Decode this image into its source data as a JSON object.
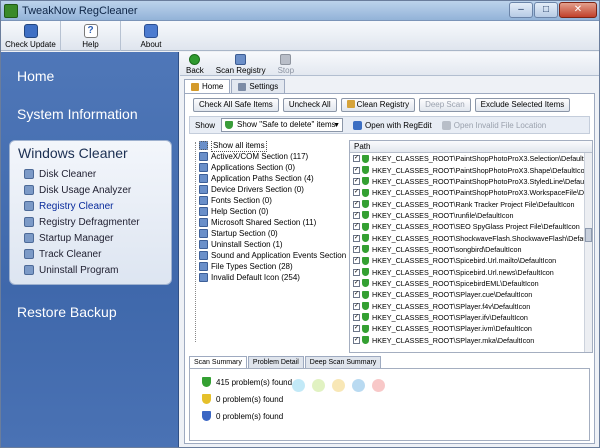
{
  "window": {
    "title": "TweakNow RegCleaner"
  },
  "caption_buttons": {
    "minimize": "–",
    "maximize": "□",
    "close": "✕"
  },
  "toolbar": {
    "check_update": "Check Update",
    "help": "Help",
    "help_glyph": "?",
    "about": "About"
  },
  "sidebar": {
    "home": "Home",
    "system_information": "System Information",
    "windows_cleaner": {
      "title": "Windows Cleaner",
      "items": [
        "Disk Cleaner",
        "Disk Usage Analyzer",
        "Registry Cleaner",
        "Registry Defragmenter",
        "Startup Manager",
        "Track Cleaner",
        "Uninstall Program"
      ],
      "active_index": 2
    },
    "restore_backup": "Restore Backup"
  },
  "subtoolbar": {
    "back": "Back",
    "scan_registry": "Scan Registry",
    "stop": "Stop"
  },
  "tabs": {
    "home": "Home",
    "settings": "Settings"
  },
  "actions": {
    "check_all_safe": "Check All Safe Items",
    "uncheck_all": "Uncheck All",
    "clean_registry": "Clean Registry",
    "deep_scan": "Deep Scan",
    "exclude_selected": "Exclude Selected Items"
  },
  "show": {
    "label": "Show",
    "selected": "Show \"Safe to delete\" items",
    "open_regedit": "Open with RegEdit",
    "open_invalid": "Open Invalid File Location"
  },
  "tree": {
    "items": [
      "Show all items",
      "ActiveX/COM Section (117)",
      "Applications Section (0)",
      "Application Paths Section (4)",
      "Device Drivers Section (0)",
      "Fonts Section (0)",
      "Help Section (0)",
      "Microsoft Shared Section (11)",
      "Startup Section (0)",
      "Uninstall Section (1)",
      "Sound and Application Events Section",
      "File Types Section (28)",
      "Invalid Default Icon (254)"
    ]
  },
  "grid": {
    "column": "Path",
    "rows": [
      "HKEY_CLASSES_ROOT\\PaintShopPhotoProX3.Selection\\DefaultI",
      "HKEY_CLASSES_ROOT\\PaintShopPhotoProX3.Shape\\DefaultIco",
      "HKEY_CLASSES_ROOT\\PaintShopPhotoProX3.StyledLine\\Defaul",
      "HKEY_CLASSES_ROOT\\PaintShopPhotoProX3.WorkspaceFile\\De",
      "HKEY_CLASSES_ROOT\\Rank Tracker Project File\\DefaultIcon",
      "HKEY_CLASSES_ROOT\\runfile\\DefaultIcon",
      "HKEY_CLASSES_ROOT\\SEO SpyGlass Project File\\DefaultIcon",
      "HKEY_CLASSES_ROOT\\ShockwaveFlash.ShockwaveFlash\\Default",
      "HKEY_CLASSES_ROOT\\songbird\\DefaultIcon",
      "HKEY_CLASSES_ROOT\\Spicebird.Url.mailto\\DefaultIcon",
      "HKEY_CLASSES_ROOT\\Spicebird.Url.news\\DefaultIcon",
      "HKEY_CLASSES_ROOT\\SpicebirdEML\\DefaultIcon",
      "HKEY_CLASSES_ROOT\\SPlayer.cue\\DefaultIcon",
      "HKEY_CLASSES_ROOT\\SPlayer.f4v\\DefaultIcon",
      "HKEY_CLASSES_ROOT\\SPlayer.ifv\\DefaultIcon",
      "HKEY_CLASSES_ROOT\\SPlayer.ivm\\DefaultIcon",
      "HKEY_CLASSES_ROOT\\SPlayer.mka\\DefaultIcon"
    ],
    "check_mark": "✓"
  },
  "bottom_tabs": [
    "Scan Summary",
    "Problem Detail",
    "Deep Scan Summary"
  ],
  "summary": [
    "415 problem(s) found",
    "0 problem(s) found",
    "0 problem(s) found"
  ],
  "decoration": {
    "dot_colors": [
      "#8fd7f0",
      "#c9e88f",
      "#f3d47a",
      "#7fbce6",
      "#f29a9a"
    ]
  }
}
